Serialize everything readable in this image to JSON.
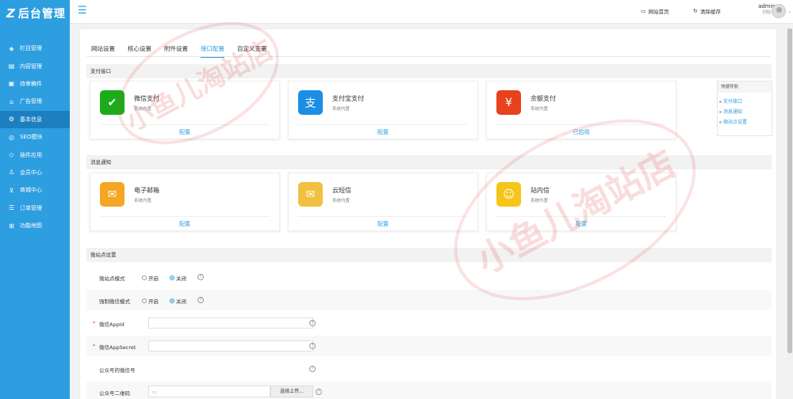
{
  "app": {
    "logo_mark": "Z",
    "title": "后台管理"
  },
  "sidebar": {
    "items": [
      {
        "label": "栏目管理",
        "icon": "layers-icon",
        "glyph": "◈"
      },
      {
        "label": "内容管理",
        "icon": "document-icon",
        "glyph": "▤"
      },
      {
        "label": "待审稿件",
        "icon": "review-icon",
        "glyph": "▣"
      },
      {
        "label": "广告管理",
        "icon": "ad-icon",
        "glyph": "⌂"
      },
      {
        "label": "基本信息",
        "icon": "gear-icon",
        "glyph": "⚙"
      },
      {
        "label": "SEO模块",
        "icon": "seo-icon",
        "glyph": "◎"
      },
      {
        "label": "插件应用",
        "icon": "plugin-icon",
        "glyph": "◇"
      },
      {
        "label": "会员中心",
        "icon": "user-icon",
        "glyph": "♙"
      },
      {
        "label": "商城中心",
        "icon": "cart-icon",
        "glyph": "⊻"
      },
      {
        "label": "订单管理",
        "icon": "order-icon",
        "glyph": "☰"
      },
      {
        "label": "功能地图",
        "icon": "grid-icon",
        "glyph": "⊞"
      }
    ],
    "active_index": 4
  },
  "topbar": {
    "site_home": "网站首页",
    "clear_cache": "清除缓存",
    "username": "admin",
    "role": "创始人"
  },
  "tabs": [
    "网站设置",
    "核心设置",
    "附件设置",
    "接口配置",
    "自定义变量"
  ],
  "active_tab": 3,
  "sections": {
    "payment": "支付接口",
    "message": "消息通知",
    "micro": "微站点设置"
  },
  "payment_cards": [
    {
      "name": "微信支付",
      "desc": "系统内置",
      "action": "配置",
      "icon": "wechat-pay-icon",
      "color": "#1aad19",
      "glyph": "✔"
    },
    {
      "name": "支付宝支付",
      "desc": "系统内置",
      "action": "配置",
      "icon": "alipay-icon",
      "color": "#1a8fe3",
      "glyph": "支"
    },
    {
      "name": "余额支付",
      "desc": "系统内置",
      "action": "已启用",
      "icon": "balance-pay-icon",
      "color": "#e8421c",
      "glyph": "¥"
    }
  ],
  "message_cards": [
    {
      "name": "电子邮箱",
      "desc": "系统内置",
      "action": "配置",
      "icon": "email-icon",
      "color": "#f5a623",
      "glyph": "✉"
    },
    {
      "name": "云短信",
      "desc": "系统内置",
      "action": "配置",
      "icon": "sms-icon",
      "color": "#f0c040",
      "glyph": "✉"
    },
    {
      "name": "站内信",
      "desc": "系统内置",
      "action": "配置",
      "icon": "site-message-icon",
      "color": "#f5c518",
      "glyph": "☺"
    }
  ],
  "quick_nav": {
    "title": "快捷导航",
    "items": [
      "支付接口",
      "消息通知",
      "微站点设置"
    ]
  },
  "form": {
    "micro_mode": "微站点模式",
    "force_wechat": "强制微信模式",
    "on": "开启",
    "off": "关闭",
    "appid": "微信AppId",
    "appsecret": "微信AppSecret",
    "account": "公众号的微信号",
    "qrcode": "公众号二维码",
    "upload": "选择上传...",
    "help": "?",
    "required": "*"
  },
  "watermark": "小鱼儿淘站店"
}
